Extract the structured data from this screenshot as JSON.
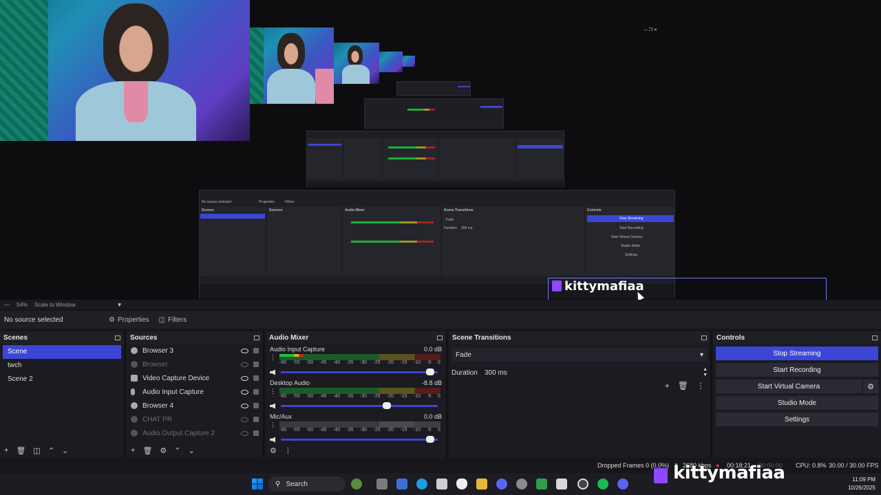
{
  "preview": {
    "nested_labels": {
      "no_source": "No source selected",
      "properties": "Properties",
      "filters": "Filters",
      "scenes": "Scenes",
      "sources": "Sources",
      "audio_mixer": "Audio Mixer",
      "scene_transitions": "Scene Transitions",
      "controls": "Controls",
      "stop_streaming": "Stop Streaming",
      "start_recording": "Start Recording",
      "start_virtual_camera": "Start Virtual Camera",
      "studio_mode": "Studio Mode",
      "settings": "Settings",
      "fade": "Fade",
      "duration": "Duration",
      "duration_value": "300 ms"
    },
    "overlay_name": "kittymafiaa"
  },
  "zoom": {
    "level": "54%",
    "mode": "Scale to Window"
  },
  "context": {
    "no_source": "No source selected",
    "properties": "Properties",
    "filters": "Filters"
  },
  "scenes": {
    "title": "Scenes",
    "items": [
      {
        "label": "Scene",
        "active": true
      },
      {
        "label": "twch",
        "active": false
      },
      {
        "label": "Scene 2",
        "active": false
      }
    ]
  },
  "sources": {
    "title": "Sources",
    "items": [
      {
        "label": "Browser 3",
        "visible": true,
        "icon": "globe-icon"
      },
      {
        "label": "Browser",
        "visible": false,
        "icon": "globe-icon"
      },
      {
        "label": "Video Capture Device",
        "visible": true,
        "icon": "camera-icon"
      },
      {
        "label": "Audio Input Capture",
        "visible": true,
        "icon": "microphone-icon"
      },
      {
        "label": "Browser 4",
        "visible": true,
        "icon": "globe-icon"
      },
      {
        "label": "CHAT PR",
        "visible": false,
        "icon": "globe-icon"
      },
      {
        "label": "Audio Output Capture 2",
        "visible": false,
        "icon": "speaker-icon"
      }
    ]
  },
  "mixer": {
    "title": "Audio Mixer",
    "ticks": [
      "-60",
      "-55",
      "-50",
      "-45",
      "-40",
      "-35",
      "-30",
      "-25",
      "-20",
      "-15",
      "-10",
      "-5",
      "0"
    ],
    "tracks": [
      {
        "name": "Audio Input Capture",
        "db": "0.0 dB",
        "level": 0.15,
        "fader": 0.98,
        "gray": false
      },
      {
        "name": "Desktop Audio",
        "db": "-8.8 dB",
        "level": 0,
        "fader": 0.7,
        "gray": false
      },
      {
        "name": "Mic/Aux",
        "db": "0.0 dB",
        "level": 0,
        "fader": 0.98,
        "gray": true
      }
    ]
  },
  "transitions": {
    "title": "Scene Transitions",
    "selected": "Fade",
    "duration_label": "Duration",
    "duration_value": "300 ms"
  },
  "controls": {
    "title": "Controls",
    "stop_streaming": "Stop Streaming",
    "start_recording": "Start Recording",
    "start_virtual_camera": "Start Virtual Camera",
    "studio_mode": "Studio Mode",
    "settings": "Settings"
  },
  "status": {
    "dropped_frames": "Dropped Frames 0 (0.0%)",
    "bitrate": "2680 kbps",
    "stream_time": "00:18:21",
    "record_time": "00:00:00",
    "cpu": "CPU: 0.8%",
    "fps": "30.00 / 30.00 FPS",
    "overlay_name": "kittymafiaa"
  },
  "taskbar": {
    "search_placeholder": "Search",
    "time": "11:09 PM",
    "date": "10/26/2025"
  },
  "colors": {
    "accent": "#3b46d6",
    "twitch": "#9146ff",
    "meter_green": "#1fc13f",
    "meter_yellow": "#c9b51f",
    "meter_red": "#cc2222"
  }
}
